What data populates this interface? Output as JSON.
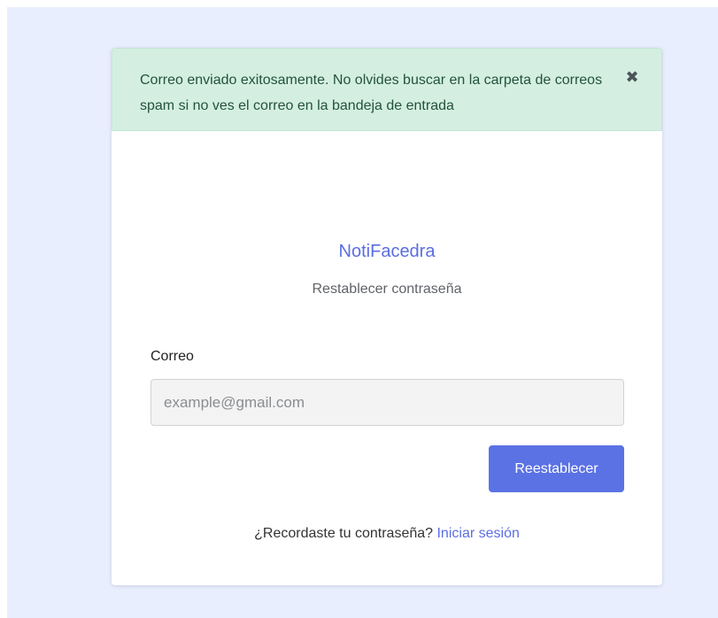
{
  "alert": {
    "message": "Correo enviado exitosamente. No olvides buscar en la carpeta de correos spam si no ves el correo en la bandeja de entrada",
    "close_glyph": "✖",
    "close_icon": "close-icon"
  },
  "brand": {
    "name": "NotiFacedra",
    "subtitle": "Restablecer contraseña"
  },
  "form": {
    "email_label": "Correo",
    "email_value": "",
    "email_placeholder": "example@gmail.com",
    "submit_label": "Reestablecer"
  },
  "footer": {
    "question": "¿Recordaste tu contraseña?",
    "login_link": "Iniciar sesión"
  },
  "colors": {
    "page_background": "#e8eefd",
    "alert_background": "#d4efe2",
    "accent": "#5b72e5",
    "link": "#5b6ee1"
  }
}
